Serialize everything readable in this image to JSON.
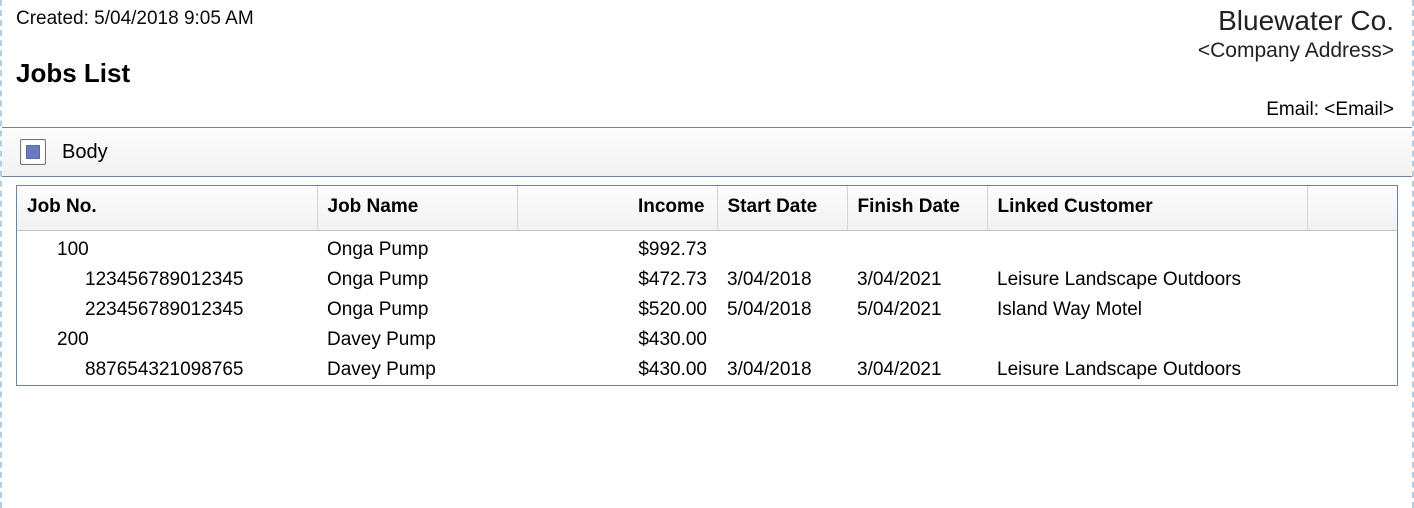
{
  "meta": {
    "created_label": "Created:",
    "created_value": "5/04/2018 9:05 AM",
    "company_name": "Bluewater Co.",
    "company_address": "<Company Address>",
    "report_title": "Jobs List",
    "email_label": "Email:",
    "email_value": "<Email>"
  },
  "section": {
    "label": "Body"
  },
  "table": {
    "headers": {
      "job_no": "Job No.",
      "job_name": "Job Name",
      "income": "Income",
      "start_date": "Start Date",
      "finish_date": "Finish Date",
      "linked_customer": "Linked Customer"
    },
    "rows": [
      {
        "level": "parent",
        "job_no": "100",
        "job_name": "Onga Pump",
        "income": "$992.73",
        "start": "",
        "finish": "",
        "customer": ""
      },
      {
        "level": "child",
        "job_no": "123456789012345",
        "job_name": "Onga Pump",
        "income": "$472.73",
        "start": "3/04/2018",
        "finish": "3/04/2021",
        "customer": "Leisure Landscape Outdoors"
      },
      {
        "level": "child",
        "job_no": "223456789012345",
        "job_name": "Onga Pump",
        "income": "$520.00",
        "start": "5/04/2018",
        "finish": "5/04/2021",
        "customer": "Island Way Motel"
      },
      {
        "level": "parent",
        "job_no": "200",
        "job_name": "Davey Pump",
        "income": "$430.00",
        "start": "",
        "finish": "",
        "customer": ""
      },
      {
        "level": "child",
        "job_no": "887654321098765",
        "job_name": "Davey Pump",
        "income": "$430.00",
        "start": "3/04/2018",
        "finish": "3/04/2021",
        "customer": "Leisure Landscape Outdoors"
      }
    ]
  }
}
